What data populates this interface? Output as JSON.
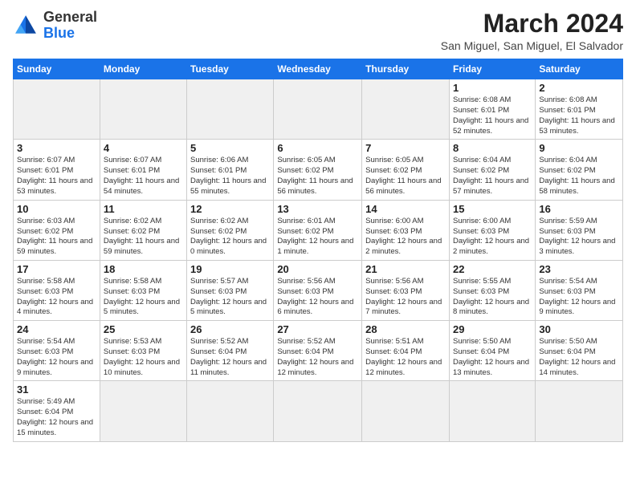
{
  "header": {
    "logo_general": "General",
    "logo_blue": "Blue",
    "month_title": "March 2024",
    "location": "San Miguel, San Miguel, El Salvador"
  },
  "weekdays": [
    "Sunday",
    "Monday",
    "Tuesday",
    "Wednesday",
    "Thursday",
    "Friday",
    "Saturday"
  ],
  "weeks": [
    [
      {
        "day": "",
        "info": "",
        "empty": true
      },
      {
        "day": "",
        "info": "",
        "empty": true
      },
      {
        "day": "",
        "info": "",
        "empty": true
      },
      {
        "day": "",
        "info": "",
        "empty": true
      },
      {
        "day": "",
        "info": "",
        "empty": true
      },
      {
        "day": "1",
        "info": "Sunrise: 6:08 AM\nSunset: 6:01 PM\nDaylight: 11 hours\nand 52 minutes."
      },
      {
        "day": "2",
        "info": "Sunrise: 6:08 AM\nSunset: 6:01 PM\nDaylight: 11 hours\nand 53 minutes."
      }
    ],
    [
      {
        "day": "3",
        "info": "Sunrise: 6:07 AM\nSunset: 6:01 PM\nDaylight: 11 hours\nand 53 minutes."
      },
      {
        "day": "4",
        "info": "Sunrise: 6:07 AM\nSunset: 6:01 PM\nDaylight: 11 hours\nand 54 minutes."
      },
      {
        "day": "5",
        "info": "Sunrise: 6:06 AM\nSunset: 6:01 PM\nDaylight: 11 hours\nand 55 minutes."
      },
      {
        "day": "6",
        "info": "Sunrise: 6:05 AM\nSunset: 6:02 PM\nDaylight: 11 hours\nand 56 minutes."
      },
      {
        "day": "7",
        "info": "Sunrise: 6:05 AM\nSunset: 6:02 PM\nDaylight: 11 hours\nand 56 minutes."
      },
      {
        "day": "8",
        "info": "Sunrise: 6:04 AM\nSunset: 6:02 PM\nDaylight: 11 hours\nand 57 minutes."
      },
      {
        "day": "9",
        "info": "Sunrise: 6:04 AM\nSunset: 6:02 PM\nDaylight: 11 hours\nand 58 minutes."
      }
    ],
    [
      {
        "day": "10",
        "info": "Sunrise: 6:03 AM\nSunset: 6:02 PM\nDaylight: 11 hours\nand 59 minutes."
      },
      {
        "day": "11",
        "info": "Sunrise: 6:02 AM\nSunset: 6:02 PM\nDaylight: 11 hours\nand 59 minutes."
      },
      {
        "day": "12",
        "info": "Sunrise: 6:02 AM\nSunset: 6:02 PM\nDaylight: 12 hours\nand 0 minutes."
      },
      {
        "day": "13",
        "info": "Sunrise: 6:01 AM\nSunset: 6:02 PM\nDaylight: 12 hours\nand 1 minute."
      },
      {
        "day": "14",
        "info": "Sunrise: 6:00 AM\nSunset: 6:03 PM\nDaylight: 12 hours\nand 2 minutes."
      },
      {
        "day": "15",
        "info": "Sunrise: 6:00 AM\nSunset: 6:03 PM\nDaylight: 12 hours\nand 2 minutes."
      },
      {
        "day": "16",
        "info": "Sunrise: 5:59 AM\nSunset: 6:03 PM\nDaylight: 12 hours\nand 3 minutes."
      }
    ],
    [
      {
        "day": "17",
        "info": "Sunrise: 5:58 AM\nSunset: 6:03 PM\nDaylight: 12 hours\nand 4 minutes."
      },
      {
        "day": "18",
        "info": "Sunrise: 5:58 AM\nSunset: 6:03 PM\nDaylight: 12 hours\nand 5 minutes."
      },
      {
        "day": "19",
        "info": "Sunrise: 5:57 AM\nSunset: 6:03 PM\nDaylight: 12 hours\nand 5 minutes."
      },
      {
        "day": "20",
        "info": "Sunrise: 5:56 AM\nSunset: 6:03 PM\nDaylight: 12 hours\nand 6 minutes."
      },
      {
        "day": "21",
        "info": "Sunrise: 5:56 AM\nSunset: 6:03 PM\nDaylight: 12 hours\nand 7 minutes."
      },
      {
        "day": "22",
        "info": "Sunrise: 5:55 AM\nSunset: 6:03 PM\nDaylight: 12 hours\nand 8 minutes."
      },
      {
        "day": "23",
        "info": "Sunrise: 5:54 AM\nSunset: 6:03 PM\nDaylight: 12 hours\nand 9 minutes."
      }
    ],
    [
      {
        "day": "24",
        "info": "Sunrise: 5:54 AM\nSunset: 6:03 PM\nDaylight: 12 hours\nand 9 minutes."
      },
      {
        "day": "25",
        "info": "Sunrise: 5:53 AM\nSunset: 6:03 PM\nDaylight: 12 hours\nand 10 minutes."
      },
      {
        "day": "26",
        "info": "Sunrise: 5:52 AM\nSunset: 6:04 PM\nDaylight: 12 hours\nand 11 minutes."
      },
      {
        "day": "27",
        "info": "Sunrise: 5:52 AM\nSunset: 6:04 PM\nDaylight: 12 hours\nand 12 minutes."
      },
      {
        "day": "28",
        "info": "Sunrise: 5:51 AM\nSunset: 6:04 PM\nDaylight: 12 hours\nand 12 minutes."
      },
      {
        "day": "29",
        "info": "Sunrise: 5:50 AM\nSunset: 6:04 PM\nDaylight: 12 hours\nand 13 minutes."
      },
      {
        "day": "30",
        "info": "Sunrise: 5:50 AM\nSunset: 6:04 PM\nDaylight: 12 hours\nand 14 minutes."
      }
    ],
    [
      {
        "day": "31",
        "info": "Sunrise: 5:49 AM\nSunset: 6:04 PM\nDaylight: 12 hours\nand 15 minutes."
      },
      {
        "day": "",
        "info": "",
        "empty": true
      },
      {
        "day": "",
        "info": "",
        "empty": true
      },
      {
        "day": "",
        "info": "",
        "empty": true
      },
      {
        "day": "",
        "info": "",
        "empty": true
      },
      {
        "day": "",
        "info": "",
        "empty": true
      },
      {
        "day": "",
        "info": "",
        "empty": true
      }
    ]
  ]
}
